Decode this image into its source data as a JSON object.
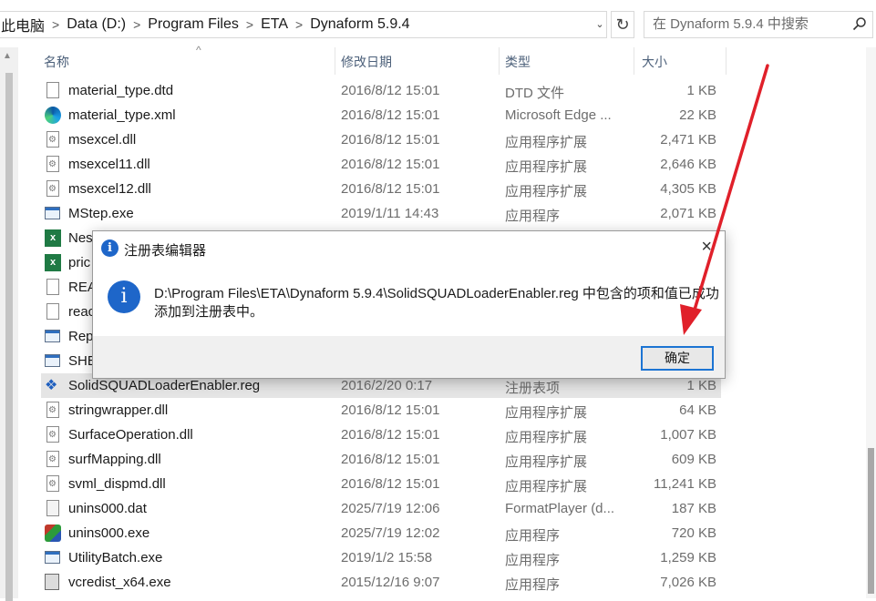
{
  "address_bar": {
    "crumbs": [
      "此电脑",
      "Data (D:)",
      "Program Files",
      "ETA",
      "Dynaform 5.9.4"
    ],
    "separator": ">"
  },
  "search": {
    "placeholder": "在 Dynaform 5.9.4 中搜索"
  },
  "columns": {
    "name": "名称",
    "date": "修改日期",
    "type": "类型",
    "size": "大小"
  },
  "files": [
    {
      "name": "material_type.dtd",
      "date": "2016/8/12 15:01",
      "type": "DTD 文件",
      "size": "1 KB",
      "icon": "document-icon"
    },
    {
      "name": "material_type.xml",
      "date": "2016/8/12 15:01",
      "type": "Microsoft Edge ...",
      "size": "22 KB",
      "icon": "edge-icon"
    },
    {
      "name": "msexcel.dll",
      "date": "2016/8/12 15:01",
      "type": "应用程序扩展",
      "size": "2,471 KB",
      "icon": "dll-icon"
    },
    {
      "name": "msexcel11.dll",
      "date": "2016/8/12 15:01",
      "type": "应用程序扩展",
      "size": "2,646 KB",
      "icon": "dll-icon"
    },
    {
      "name": "msexcel12.dll",
      "date": "2016/8/12 15:01",
      "type": "应用程序扩展",
      "size": "4,305 KB",
      "icon": "dll-icon"
    },
    {
      "name": "MStep.exe",
      "date": "2019/1/11 14:43",
      "type": "应用程序",
      "size": "2,071 KB",
      "icon": "exe-icon"
    },
    {
      "name": "Nes",
      "date": "",
      "type": "",
      "size": "",
      "icon": "excel-icon"
    },
    {
      "name": "pric",
      "date": "",
      "type": "",
      "size": "",
      "icon": "excel-icon"
    },
    {
      "name": "REA",
      "date": "",
      "type": "",
      "size": "",
      "icon": "document-icon"
    },
    {
      "name": "reac",
      "date": "",
      "type": "",
      "size": "",
      "icon": "document-icon"
    },
    {
      "name": "Rep",
      "date": "",
      "type": "",
      "size": "",
      "icon": "exe-icon"
    },
    {
      "name": "SHE",
      "date": "",
      "type": "",
      "size": "",
      "icon": "exe-icon"
    },
    {
      "name": "SolidSQUADLoaderEnabler.reg",
      "date": "2016/2/20 0:17",
      "type": "注册表项",
      "size": "1 KB",
      "icon": "registry-icon",
      "selected": true
    },
    {
      "name": "stringwrapper.dll",
      "date": "2016/8/12 15:01",
      "type": "应用程序扩展",
      "size": "64 KB",
      "icon": "dll-icon"
    },
    {
      "name": "SurfaceOperation.dll",
      "date": "2016/8/12 15:01",
      "type": "应用程序扩展",
      "size": "1,007 KB",
      "icon": "dll-icon"
    },
    {
      "name": "surfMapping.dll",
      "date": "2016/8/12 15:01",
      "type": "应用程序扩展",
      "size": "609 KB",
      "icon": "dll-icon"
    },
    {
      "name": "svml_dispmd.dll",
      "date": "2016/8/12 15:01",
      "type": "应用程序扩展",
      "size": "11,241 KB",
      "icon": "dll-icon"
    },
    {
      "name": "unins000.dat",
      "date": "2025/7/19 12:06",
      "type": "FormatPlayer (d...",
      "size": "187 KB",
      "icon": "dat-icon"
    },
    {
      "name": "unins000.exe",
      "date": "2025/7/19 12:02",
      "type": "应用程序",
      "size": "720 KB",
      "icon": "installer-icon"
    },
    {
      "name": "UtilityBatch.exe",
      "date": "2019/1/2 15:58",
      "type": "应用程序",
      "size": "1,259 KB",
      "icon": "exe-icon"
    },
    {
      "name": "vcredist_x64.exe",
      "date": "2015/12/16 9:07",
      "type": "应用程序",
      "size": "7,026 KB",
      "icon": "vcredist-icon"
    }
  ],
  "dialog": {
    "title": "注册表编辑器",
    "message": "D:\\Program Files\\ETA\\Dynaform 5.9.4\\SolidSQUADLoaderEnabler.reg 中包含的项和值已成功添加到注册表中。",
    "ok_label": "确定",
    "close_glyph": "×",
    "title_icon": "info-icon",
    "message_icon": "info-icon"
  },
  "colors": {
    "accent": "#1c74d3",
    "info_icon": "#1e66c9",
    "annotation_arrow": "#e0202a",
    "selected_row": "#e5e5e5"
  }
}
